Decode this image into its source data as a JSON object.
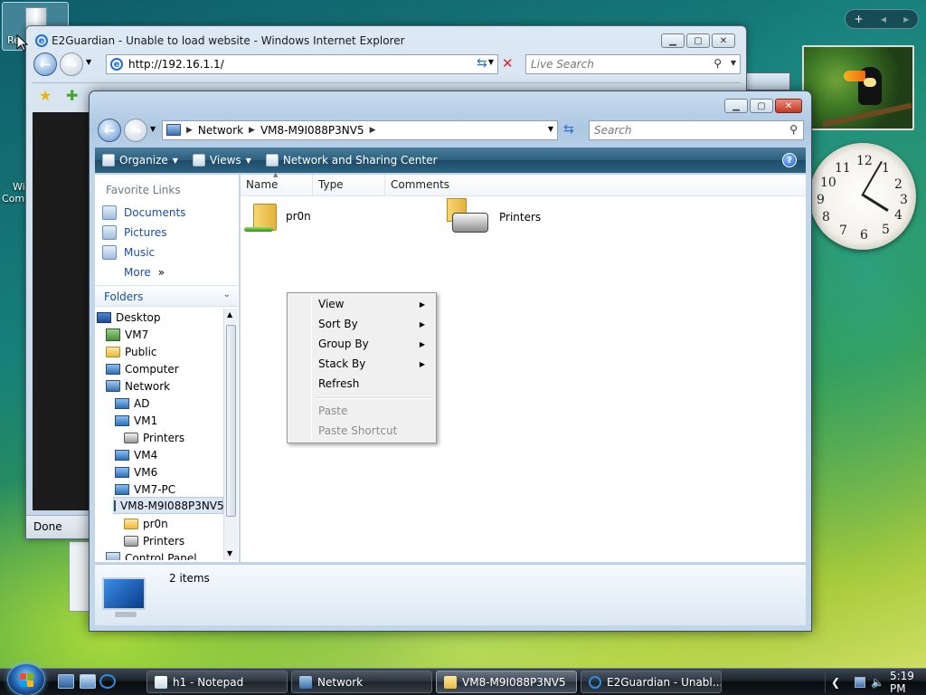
{
  "desktop": {
    "icon_recycle_label": "Re",
    "icon_computer_label_line1": "Wi",
    "icon_computer_label_line2": "Com"
  },
  "ie": {
    "title": "E2Guardian - Unable to load website - Windows Internet Explorer",
    "address": "http://192.16.1.1/",
    "search_placeholder": "Live Search",
    "status": "Done"
  },
  "explorer": {
    "breadcrumb": [
      "Network",
      "VM8-M9I088P3NV5"
    ],
    "search_placeholder": "Search",
    "toolbar": {
      "organize": "Organize",
      "views": "Views",
      "network_center": "Network and Sharing Center"
    },
    "favorites": {
      "heading": "Favorite Links",
      "links": [
        "Documents",
        "Pictures",
        "Music"
      ],
      "more": "More"
    },
    "folders_label": "Folders",
    "tree": [
      "Desktop",
      "VM7",
      "Public",
      "Computer",
      "Network",
      "AD",
      "VM1",
      "Printers",
      "VM4",
      "VM6",
      "VM7-PC",
      "VM8-M9I088P3NV5",
      "pr0n",
      "Printers",
      "Control Panel"
    ],
    "columns": [
      "Name",
      "Type",
      "Comments"
    ],
    "items": [
      {
        "name": "pr0n"
      },
      {
        "name": "Printers"
      }
    ],
    "item_count": "2 items"
  },
  "context_menu": {
    "items": [
      "View",
      "Sort By",
      "Group By",
      "Stack By",
      "Refresh"
    ],
    "disabled_items": [
      "Paste",
      "Paste Shortcut"
    ]
  },
  "taskbar": {
    "buttons": [
      "h1 - Notepad",
      "Network",
      "VM8-M9I088P3NV5",
      "E2Guardian - Unabl..."
    ],
    "active_index": 2,
    "clock": "5:19 PM"
  },
  "colors": {
    "accent": "#2d5f7e",
    "link": "#1c4fa3"
  }
}
